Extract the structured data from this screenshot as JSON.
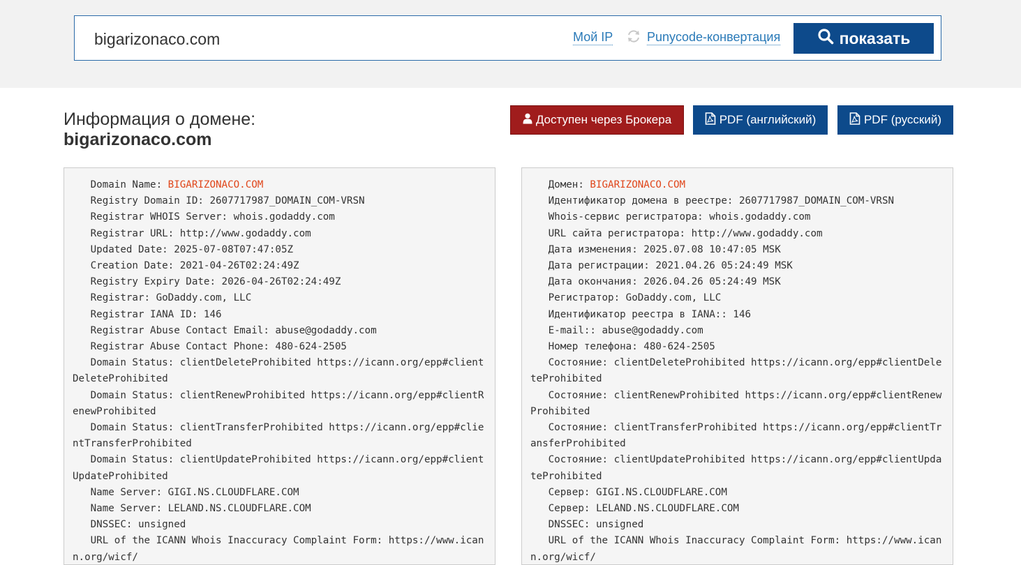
{
  "search": {
    "value": "bigarizonaco.com",
    "my_ip_label": "Мой IP",
    "punycode_label": "Punycode-конвертация",
    "show_label": "показать"
  },
  "header": {
    "title": "Информация о домене:",
    "domain": "bigarizonaco.com"
  },
  "actions": {
    "broker": "Доступен через Брокера",
    "pdf_en": "PDF (английский)",
    "pdf_ru": "PDF (русский)"
  },
  "colors": {
    "primary": "#0d4a8b",
    "danger": "#a01c1c",
    "link": "#2a7ab8",
    "highlight": "#e0461a"
  },
  "whois_en": [
    {
      "key": "   Domain Name: ",
      "value": "BIGARIZONACO.COM",
      "highlight": true
    },
    {
      "key": "   Registry Domain ID: ",
      "value": "2607717987_DOMAIN_COM-VRSN"
    },
    {
      "key": "   Registrar WHOIS Server: ",
      "value": "whois.godaddy.com"
    },
    {
      "key": "   Registrar URL: ",
      "value": "http://www.godaddy.com"
    },
    {
      "key": "   Updated Date: ",
      "value": "2025-07-08T07:47:05Z"
    },
    {
      "key": "   Creation Date: ",
      "value": "2021-04-26T02:24:49Z"
    },
    {
      "key": "   Registry Expiry Date: ",
      "value": "2026-04-26T02:24:49Z"
    },
    {
      "key": "   Registrar: ",
      "value": "GoDaddy.com, LLC"
    },
    {
      "key": "   Registrar IANA ID: ",
      "value": "146"
    },
    {
      "key": "   Registrar Abuse Contact Email: ",
      "value": "abuse@godaddy.com"
    },
    {
      "key": "   Registrar Abuse Contact Phone: ",
      "value": "480-624-2505"
    },
    {
      "key": "   Domain Status: ",
      "value": "clientDeleteProhibited https://icann.org/epp#clientDeleteProhibited"
    },
    {
      "key": "   Domain Status: ",
      "value": "clientRenewProhibited https://icann.org/epp#clientRenewProhibited"
    },
    {
      "key": "   Domain Status: ",
      "value": "clientTransferProhibited https://icann.org/epp#clientTransferProhibited"
    },
    {
      "key": "   Domain Status: ",
      "value": "clientUpdateProhibited https://icann.org/epp#clientUpdateProhibited"
    },
    {
      "key": "   Name Server: ",
      "value": "GIGI.NS.CLOUDFLARE.COM"
    },
    {
      "key": "   Name Server: ",
      "value": "LELAND.NS.CLOUDFLARE.COM"
    },
    {
      "key": "   DNSSEC: ",
      "value": "unsigned"
    },
    {
      "key": "   URL of the ICANN Whois Inaccuracy Complaint Form: ",
      "value": "https://www.icann.org/wicf/"
    }
  ],
  "whois_ru": [
    {
      "key": "   Домен: ",
      "value": "BIGARIZONACO.COM",
      "highlight": true
    },
    {
      "key": "   Идентификатор домена в реестре: ",
      "value": "2607717987_DOMAIN_COM-VRSN"
    },
    {
      "key": "   Whois-сервис регистратора: ",
      "value": "whois.godaddy.com"
    },
    {
      "key": "   URL сайта регистратора: ",
      "value": "http://www.godaddy.com"
    },
    {
      "key": "   Дата изменения: ",
      "value": "2025.07.08 10:47:05 MSK"
    },
    {
      "key": "   Дата регистрации: ",
      "value": "2021.04.26 05:24:49 MSK"
    },
    {
      "key": "   Дата окончания: ",
      "value": "2026.04.26 05:24:49 MSK"
    },
    {
      "key": "   Регистратор: ",
      "value": "GoDaddy.com, LLC"
    },
    {
      "key": "   Идентификатор реестра в IANA:: ",
      "value": "146"
    },
    {
      "key": "   E-mail:: ",
      "value": "abuse@godaddy.com"
    },
    {
      "key": "   Номер телефона: ",
      "value": "480-624-2505"
    },
    {
      "key": "   Состояние: ",
      "value": "clientDeleteProhibited https://icann.org/epp#clientDeleteProhibited"
    },
    {
      "key": "   Состояние: ",
      "value": "clientRenewProhibited https://icann.org/epp#clientRenewProhibited"
    },
    {
      "key": "   Состояние: ",
      "value": "clientTransferProhibited https://icann.org/epp#clientTransferProhibited"
    },
    {
      "key": "   Состояние: ",
      "value": "clientUpdateProhibited https://icann.org/epp#clientUpdateProhibited"
    },
    {
      "key": "   Сервер: ",
      "value": "GIGI.NS.CLOUDFLARE.COM"
    },
    {
      "key": "   Сервер: ",
      "value": "LELAND.NS.CLOUDFLARE.COM"
    },
    {
      "key": "   DNSSEC: ",
      "value": "unsigned"
    },
    {
      "key": "   URL of the ICANN Whois Inaccuracy Complaint Form: ",
      "value": "https://www.icann.org/wicf/"
    }
  ]
}
